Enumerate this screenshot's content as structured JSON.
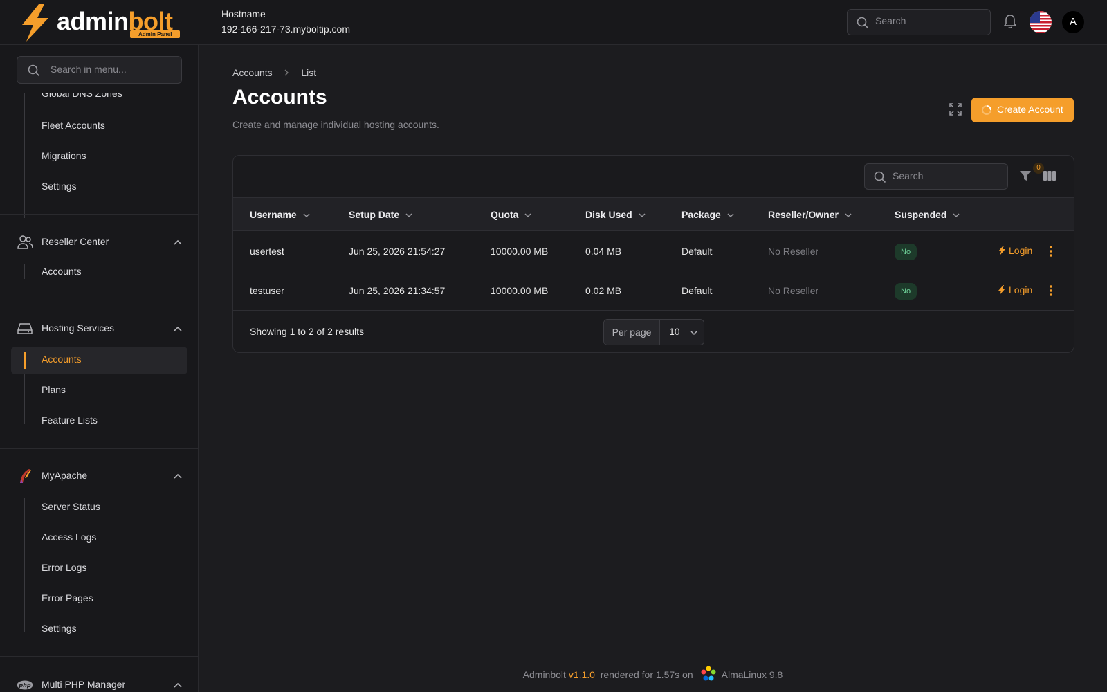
{
  "topbar": {
    "logo": {
      "part1": "admin",
      "part2": "bolt",
      "badge": "Admin Panel"
    },
    "hostname_label": "Hostname",
    "hostname_value": "192-166-217-73.myboltip.com",
    "search_placeholder": "Search",
    "avatar_letter": "A",
    "flag": "us-flag-icon"
  },
  "sidebar": {
    "search_placeholder": "Search in menu...",
    "partial_item": "Global DNS Zones",
    "top_items": [
      "Fleet Accounts",
      "Migrations",
      "Settings"
    ],
    "groups": [
      {
        "label": "Reseller Center",
        "icon": "users-icon",
        "items": [
          "Accounts"
        ]
      },
      {
        "label": "Hosting Services",
        "icon": "server-drive-icon",
        "items": [
          "Accounts",
          "Plans",
          "Feature Lists"
        ],
        "active": "Accounts"
      },
      {
        "label": "MyApache",
        "icon": "apache-feather-icon",
        "items": [
          "Server Status",
          "Access Logs",
          "Error Logs",
          "Error Pages",
          "Settings"
        ]
      },
      {
        "label": "Multi PHP Manager",
        "icon": "php-icon",
        "items": []
      }
    ]
  },
  "main": {
    "breadcrumb": [
      "Accounts",
      "List"
    ],
    "title": "Accounts",
    "subtitle": "Create and manage individual hosting accounts.",
    "create_button": "Create Account",
    "table": {
      "search_placeholder": "Search",
      "filter_count": "0",
      "columns": [
        "Username",
        "Setup Date",
        "Quota",
        "Disk Used",
        "Package",
        "Reseller/Owner",
        "Suspended"
      ],
      "rows": [
        {
          "username": "usertest",
          "setup_date": "Jun 25, 2026 21:54:27",
          "quota": "10000.00 MB",
          "disk_used": "0.04 MB",
          "package": "Default",
          "reseller": "No Reseller",
          "suspended": "No",
          "action": "Login"
        },
        {
          "username": "testuser",
          "setup_date": "Jun 25, 2026 21:34:57",
          "quota": "10000.00 MB",
          "disk_used": "0.02 MB",
          "package": "Default",
          "reseller": "No Reseller",
          "suspended": "No",
          "action": "Login"
        }
      ],
      "showing": "Showing 1 to 2 of 2 results",
      "per_page_label": "Per page",
      "per_page_value": "10"
    }
  },
  "footer": {
    "app": "Adminbolt",
    "version": "v1.1.0",
    "rendered": "rendered for 1.57s on",
    "os": "AlmaLinux 9.8"
  },
  "colors": {
    "accent": "#f59e2b",
    "background": "#1c1c1f",
    "success": "#6fd49a"
  }
}
